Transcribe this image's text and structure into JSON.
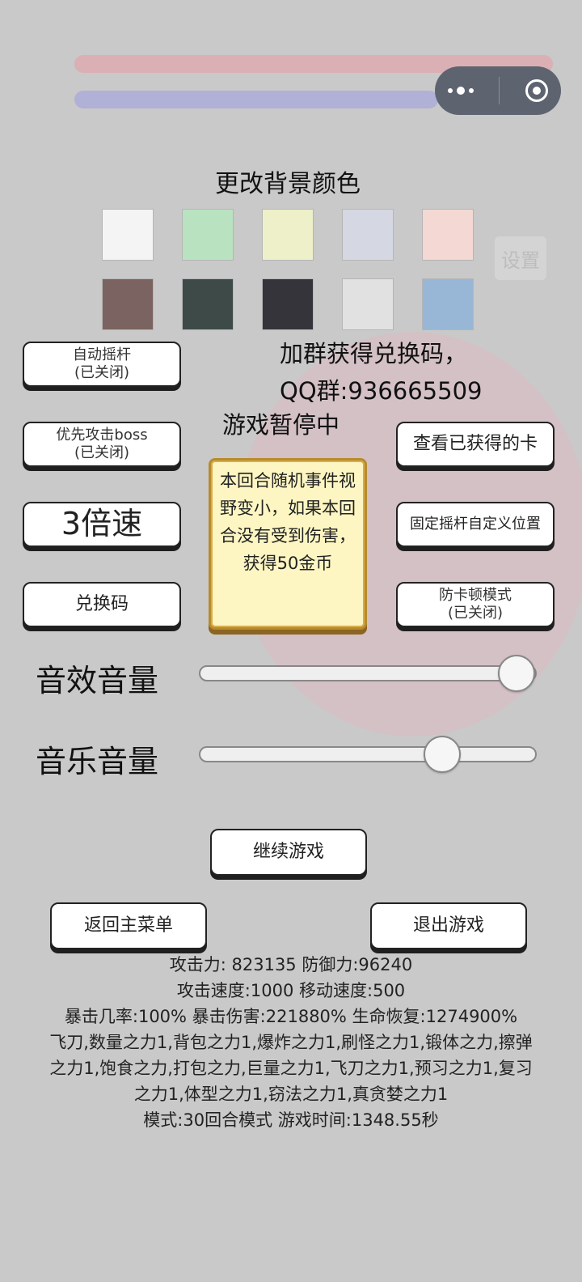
{
  "capsule": {
    "more_icon": "more-dots-icon",
    "close_icon": "close-target-icon"
  },
  "background": {
    "settings_label": "设置"
  },
  "bg_colors": {
    "title": "更改背景颜色",
    "swatches": [
      "#f4f4f4",
      "#b9e3c0",
      "#eef0c9",
      "#d5d8e3",
      "#f3d8d3",
      "#7a6360",
      "#3e4a47",
      "#34343a",
      "#e1e1e1",
      "#98b7d6"
    ]
  },
  "group_info": {
    "line1": "加群获得兑换码，",
    "line2": "QQ群:936665509"
  },
  "paused_text": "游戏暂停中",
  "buttons": {
    "auto_joystick": {
      "label": "自动摇杆",
      "state": "(已关闭)"
    },
    "boss_priority": {
      "label": "优先攻击boss",
      "state": "(已关闭)"
    },
    "speed": "3倍速",
    "redeem": "兑换码",
    "view_cards": "查看已获得的卡",
    "fixed_joystick": "固定摇杆自定义位置",
    "anti_lag": {
      "label": "防卡顿模式",
      "state": "(已关闭)"
    },
    "continue": "继续游戏",
    "main_menu": "返回主菜单",
    "exit": "退出游戏"
  },
  "event_notice": "本回合随机事件视野变小，如果本回合没有受到伤害，获得50金币",
  "volume": {
    "sfx_label": "音效音量",
    "sfx_level": 0.94,
    "music_label": "音乐音量",
    "music_level": 0.72
  },
  "stats": {
    "line1": "攻击力: 823135 防御力:96240",
    "line2": "攻击速度:1000 移动速度:500",
    "line3": "暴击几率:100% 暴击伤害:221880% 生命恢复:1274900%",
    "line4": "飞刀,数量之力1,背包之力1,爆炸之力1,刷怪之力1,锻体之力,擦弹",
    "line5": "之力1,饱食之力,打包之力,巨量之力1,飞刀之力1,预习之力1,复习",
    "line6": "之力1,体型之力1,窃法之力1,真贪婪之力1",
    "line7": "模式:30回合模式 游戏时间:1348.55秒"
  }
}
